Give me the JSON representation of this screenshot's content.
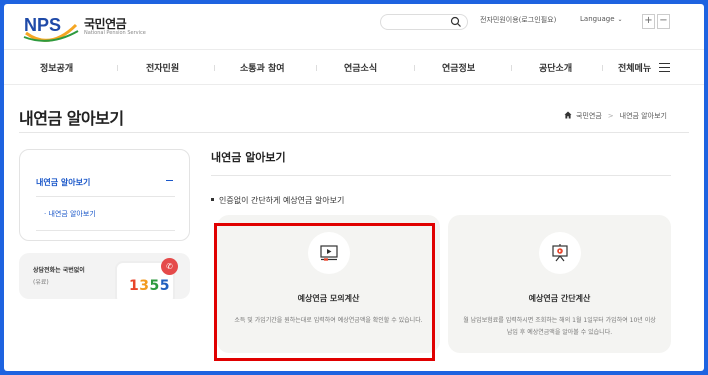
{
  "header": {
    "logo_text": "NPS",
    "logo_ko": "국민연금",
    "logo_en": "National Pension Service",
    "login_link": "전자민원이용(로그인필요)",
    "language_label": "Language",
    "zoom_in": "+",
    "zoom_out": "−"
  },
  "nav": {
    "items": [
      "정보공개",
      "전자민원",
      "소통과 참여",
      "연금소식",
      "연금정보",
      "공단소개",
      "전체메뉴"
    ]
  },
  "page": {
    "title": "내연금 알아보기",
    "breadcrumb": [
      "국민연금",
      "내연금 알아보기"
    ]
  },
  "sidebar": {
    "active_label": "내연금 알아보기",
    "sub_item": "· 내연금 알아보기",
    "call_title": "상담전화는 국번없이",
    "call_note": "(유료)",
    "phone_digits": [
      "1",
      "3",
      "5",
      "5"
    ],
    "phone_colors": [
      "#e8452c",
      "#f29a1f",
      "#2d9a3e",
      "#1f5fbf"
    ]
  },
  "main": {
    "heading": "내연금 알아보기",
    "intro": "인증없이 간단하게 예상연금 알아보기",
    "cards": [
      {
        "title": "예상연금 모의계산",
        "desc": "소득 및 가입기간을 원하는대로 입력하여 예상연금액을 확인할 수 있습니다.",
        "icon": "video-play-icon"
      },
      {
        "title": "예상연금 간단계산",
        "desc": "월 납입보험료를 입력하시면 조회하는 해의 1월 1일부터 가입하여 10년 이상 납입 후 예상연금액을 알아볼 수 있습니다.",
        "icon": "presentation-play-icon"
      }
    ]
  },
  "colors": {
    "accent": "#1a57c9",
    "highlight": "#e00000",
    "frame": "#1e63e0"
  }
}
